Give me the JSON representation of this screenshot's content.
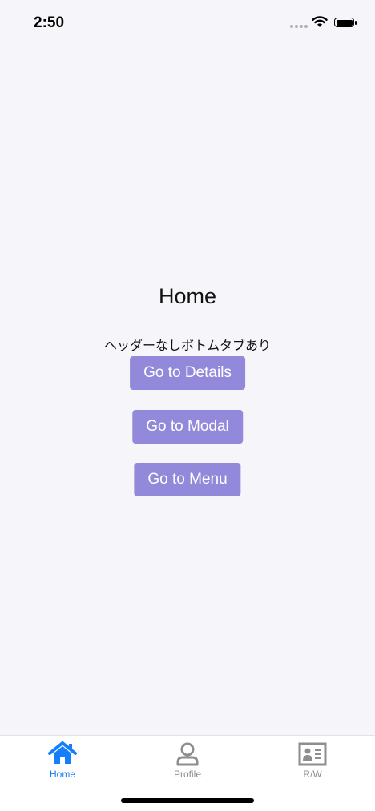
{
  "status_bar": {
    "time": "2:50"
  },
  "main": {
    "title": "Home",
    "subtitle": "ヘッダーなしボトムタブあり",
    "buttons": [
      {
        "label": "Go to Details"
      },
      {
        "label": "Go to Modal"
      },
      {
        "label": "Go to Menu"
      }
    ]
  },
  "tab_bar": {
    "items": [
      {
        "label": "Home",
        "icon": "home-icon",
        "active": true
      },
      {
        "label": "Profile",
        "icon": "person-icon",
        "active": false
      },
      {
        "label": "R/W",
        "icon": "id-card-icon",
        "active": false
      }
    ]
  },
  "colors": {
    "accent": "#147efb",
    "inactive": "#8e8e8e",
    "button": "#9389db",
    "background": "#f6f5fa"
  }
}
